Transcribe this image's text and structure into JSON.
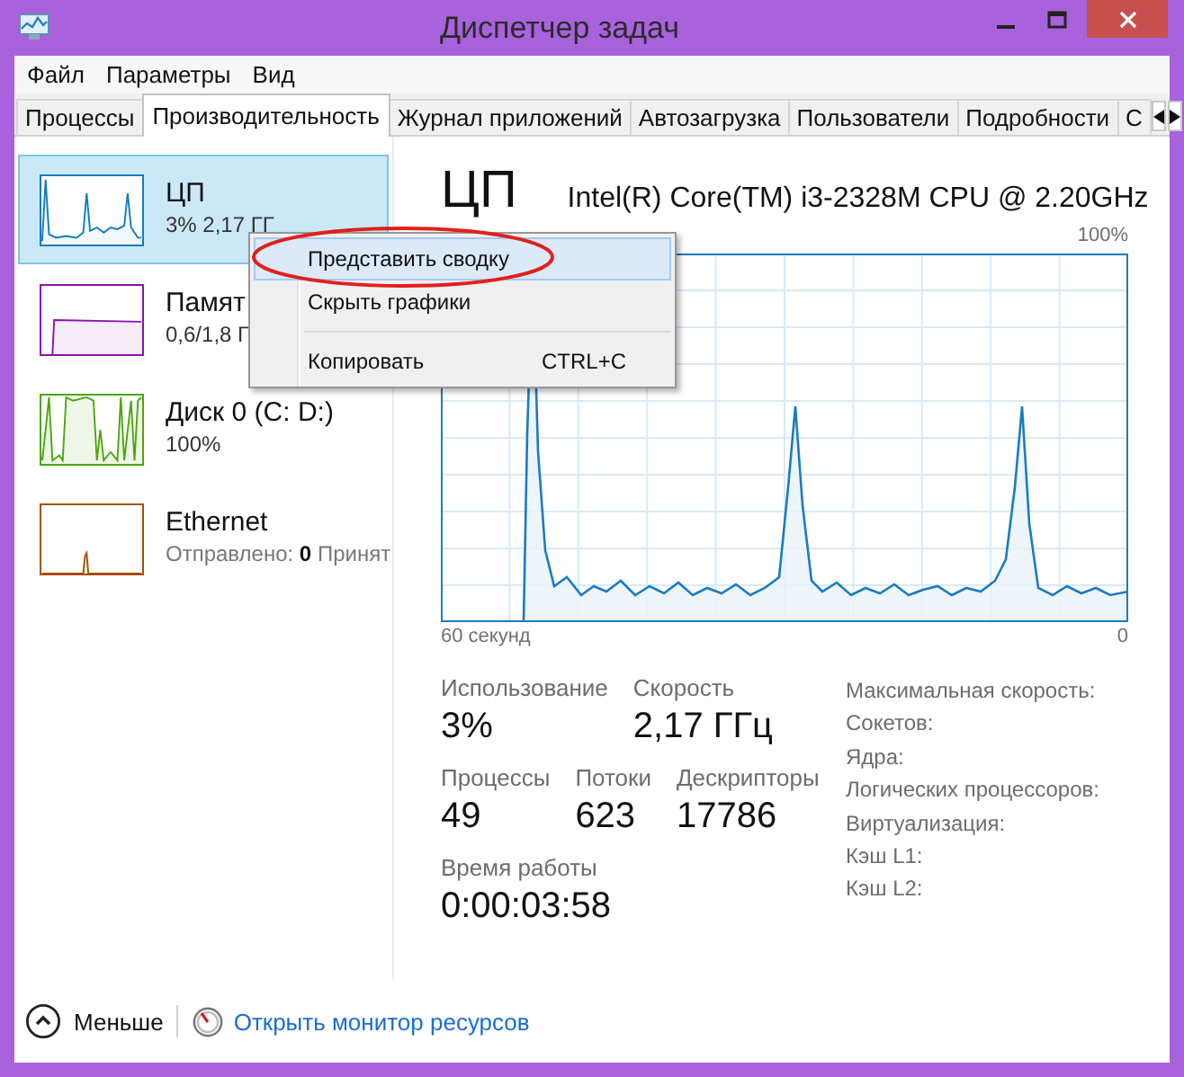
{
  "window": {
    "title": "Диспетчер задач"
  },
  "menu": [
    {
      "label": "Файл"
    },
    {
      "label": "Параметры"
    },
    {
      "label": "Вид"
    }
  ],
  "tabs": [
    {
      "label": "Процессы",
      "selected": false
    },
    {
      "label": "Производительность",
      "selected": true
    },
    {
      "label": "Журнал приложений",
      "selected": false
    },
    {
      "label": "Автозагрузка",
      "selected": false
    },
    {
      "label": "Пользователи",
      "selected": false
    },
    {
      "label": "Подробности",
      "selected": false
    },
    {
      "label": "С",
      "selected": false
    }
  ],
  "sidebar": {
    "items": [
      {
        "kind": "cpu",
        "name": "ЦП",
        "detail": "3% 2,17 ГГ",
        "selected": true,
        "color": "#117dbb"
      },
      {
        "kind": "memory",
        "name": "Памят",
        "detail": "0,6/1,8 Г",
        "selected": false,
        "color": "#8b12ae"
      },
      {
        "kind": "disk",
        "name": "Диск 0 (C: D:)",
        "detail": "100%",
        "selected": false,
        "color": "#4da60c"
      },
      {
        "kind": "network",
        "name": "Ethernet",
        "detail": "Отправлено: **0** Принят",
        "selected": false,
        "color": "#a74f01"
      }
    ]
  },
  "panel": {
    "title": "ЦП",
    "model": "Intel(R) Core(TM) i3-2328M CPU @ 2.20GHz",
    "scale_max": "100%",
    "time_span": "60 секунд",
    "time_end": "0",
    "stat_rows": [
      {
        "stats": [
          {
            "label": "Использование",
            "value": "3%"
          },
          {
            "label": "Скорость",
            "value": "2,17 ГГц"
          }
        ]
      },
      {
        "stats": [
          {
            "label": "Процессы",
            "value": "49"
          },
          {
            "label": "Потоки",
            "value": "623"
          },
          {
            "label": "Дескрипторы",
            "value": "17786"
          }
        ]
      },
      {
        "stats": [
          {
            "label": "Время работы",
            "value": "0:00:03:58"
          }
        ]
      }
    ],
    "specs": [
      "Максимальная скорость:",
      "Сокетов:",
      "Ядра:",
      "Логических процессоров:",
      "Виртуализация:",
      "Кэш L1:",
      "Кэш L2:"
    ]
  },
  "footer": {
    "fewer": "Меньше",
    "link": "Открыть монитор ресурсов"
  },
  "context_menu": {
    "items": [
      {
        "label": "Представить сводку",
        "selected": true,
        "circled": true,
        "separator_before": false
      },
      {
        "label": "Скрыть графики",
        "selected": false,
        "circled": false,
        "separator_before": false
      },
      {
        "label": "Копировать",
        "shortcut": "CTRL+C",
        "selected": false,
        "circled": false,
        "separator_before": true
      }
    ]
  }
}
